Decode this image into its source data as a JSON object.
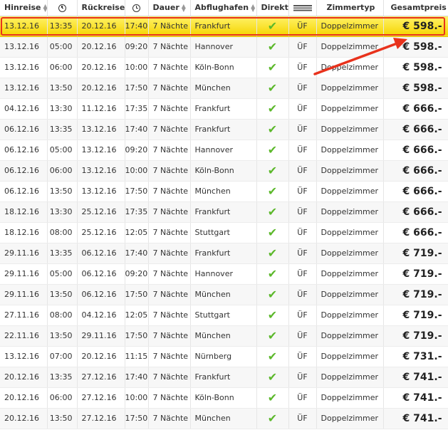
{
  "header": {
    "hinreise": "Hinreise",
    "rueckreise": "Rückreise",
    "dauer": "Dauer",
    "abflughafen": "Abflughafen",
    "direkt": "Direkt",
    "zimmertyp": "Zimmertyp",
    "gesamtpreis": "Gesamtpreis",
    "icons": {
      "sort": "sort-up-down-icon",
      "time": "clock-icon",
      "meal": "cutlery-icon",
      "sort_desc": "sort-down-icon"
    }
  },
  "rows": [
    {
      "dep_date": "13.12.16",
      "dep_time": "13:35",
      "ret_date": "20.12.16",
      "ret_time": "17:40",
      "duration": "7 Nächte",
      "airport": "Frankfurt",
      "board": "ÜF",
      "room": "Doppelzimmer",
      "price": "€ 598.-",
      "highlighted": true
    },
    {
      "dep_date": "13.12.16",
      "dep_time": "05:00",
      "ret_date": "20.12.16",
      "ret_time": "09:20",
      "duration": "7 Nächte",
      "airport": "Hannover",
      "board": "ÜF",
      "room": "Doppelzimmer",
      "price": "€ 598.-"
    },
    {
      "dep_date": "13.12.16",
      "dep_time": "06:00",
      "ret_date": "20.12.16",
      "ret_time": "10:00",
      "duration": "7 Nächte",
      "airport": "Köln-Bonn",
      "board": "ÜF",
      "room": "Doppelzimmer",
      "price": "€ 598.-"
    },
    {
      "dep_date": "13.12.16",
      "dep_time": "13:50",
      "ret_date": "20.12.16",
      "ret_time": "17:50",
      "duration": "7 Nächte",
      "airport": "München",
      "board": "ÜF",
      "room": "Doppelzimmer",
      "price": "€ 598.-"
    },
    {
      "dep_date": "04.12.16",
      "dep_time": "13:30",
      "ret_date": "11.12.16",
      "ret_time": "17:35",
      "duration": "7 Nächte",
      "airport": "Frankfurt",
      "board": "ÜF",
      "room": "Doppelzimmer",
      "price": "€ 666.-"
    },
    {
      "dep_date": "06.12.16",
      "dep_time": "13:35",
      "ret_date": "13.12.16",
      "ret_time": "17:40",
      "duration": "7 Nächte",
      "airport": "Frankfurt",
      "board": "ÜF",
      "room": "Doppelzimmer",
      "price": "€ 666.-"
    },
    {
      "dep_date": "06.12.16",
      "dep_time": "05:00",
      "ret_date": "13.12.16",
      "ret_time": "09:20",
      "duration": "7 Nächte",
      "airport": "Hannover",
      "board": "ÜF",
      "room": "Doppelzimmer",
      "price": "€ 666.-"
    },
    {
      "dep_date": "06.12.16",
      "dep_time": "06:00",
      "ret_date": "13.12.16",
      "ret_time": "10:00",
      "duration": "7 Nächte",
      "airport": "Köln-Bonn",
      "board": "ÜF",
      "room": "Doppelzimmer",
      "price": "€ 666.-"
    },
    {
      "dep_date": "06.12.16",
      "dep_time": "13:50",
      "ret_date": "13.12.16",
      "ret_time": "17:50",
      "duration": "7 Nächte",
      "airport": "München",
      "board": "ÜF",
      "room": "Doppelzimmer",
      "price": "€ 666.-"
    },
    {
      "dep_date": "18.12.16",
      "dep_time": "13:30",
      "ret_date": "25.12.16",
      "ret_time": "17:35",
      "duration": "7 Nächte",
      "airport": "Frankfurt",
      "board": "ÜF",
      "room": "Doppelzimmer",
      "price": "€ 666.-"
    },
    {
      "dep_date": "18.12.16",
      "dep_time": "08:00",
      "ret_date": "25.12.16",
      "ret_time": "12:05",
      "duration": "7 Nächte",
      "airport": "Stuttgart",
      "board": "ÜF",
      "room": "Doppelzimmer",
      "price": "€ 666.-"
    },
    {
      "dep_date": "29.11.16",
      "dep_time": "13:35",
      "ret_date": "06.12.16",
      "ret_time": "17:40",
      "duration": "7 Nächte",
      "airport": "Frankfurt",
      "board": "ÜF",
      "room": "Doppelzimmer",
      "price": "€ 719.-"
    },
    {
      "dep_date": "29.11.16",
      "dep_time": "05:00",
      "ret_date": "06.12.16",
      "ret_time": "09:20",
      "duration": "7 Nächte",
      "airport": "Hannover",
      "board": "ÜF",
      "room": "Doppelzimmer",
      "price": "€ 719.-"
    },
    {
      "dep_date": "29.11.16",
      "dep_time": "13:50",
      "ret_date": "06.12.16",
      "ret_time": "17:50",
      "duration": "7 Nächte",
      "airport": "München",
      "board": "ÜF",
      "room": "Doppelzimmer",
      "price": "€ 719.-"
    },
    {
      "dep_date": "27.11.16",
      "dep_time": "08:00",
      "ret_date": "04.12.16",
      "ret_time": "12:05",
      "duration": "7 Nächte",
      "airport": "Stuttgart",
      "board": "ÜF",
      "room": "Doppelzimmer",
      "price": "€ 719.-"
    },
    {
      "dep_date": "22.11.16",
      "dep_time": "13:50",
      "ret_date": "29.11.16",
      "ret_time": "17:50",
      "duration": "7 Nächte",
      "airport": "München",
      "board": "ÜF",
      "room": "Doppelzimmer",
      "price": "€ 719.-"
    },
    {
      "dep_date": "13.12.16",
      "dep_time": "07:00",
      "ret_date": "20.12.16",
      "ret_time": "11:15",
      "duration": "7 Nächte",
      "airport": "Nürnberg",
      "board": "ÜF",
      "room": "Doppelzimmer",
      "price": "€ 731.-"
    },
    {
      "dep_date": "20.12.16",
      "dep_time": "13:35",
      "ret_date": "27.12.16",
      "ret_time": "17:40",
      "duration": "7 Nächte",
      "airport": "Frankfurt",
      "board": "ÜF",
      "room": "Doppelzimmer",
      "price": "€ 741.-"
    },
    {
      "dep_date": "20.12.16",
      "dep_time": "06:00",
      "ret_date": "27.12.16",
      "ret_time": "10:00",
      "duration": "7 Nächte",
      "airport": "Köln-Bonn",
      "board": "ÜF",
      "room": "Doppelzimmer",
      "price": "€ 741.-"
    },
    {
      "dep_date": "20.12.16",
      "dep_time": "13:50",
      "ret_date": "27.12.16",
      "ret_time": "17:50",
      "duration": "7 Nächte",
      "airport": "München",
      "board": "ÜF",
      "room": "Doppelzimmer",
      "price": "€ 741.-"
    }
  ],
  "colors": {
    "highlight": "#f5d400",
    "annotation": "#e8321c",
    "check": "#5cb82b"
  }
}
